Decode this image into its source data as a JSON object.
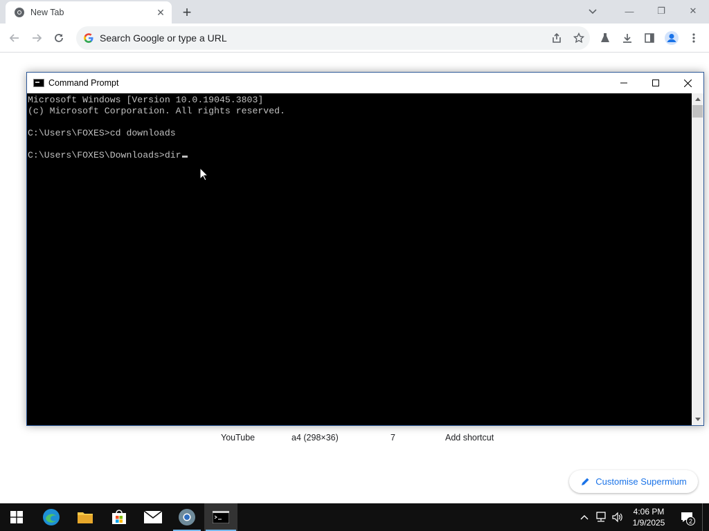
{
  "browser": {
    "tab": {
      "title": "New Tab"
    },
    "omnibox": {
      "placeholder": "Search Google or type a URL"
    }
  },
  "ntp": {
    "shortcuts": [
      "YouTube",
      "a4 (298×36)",
      "7",
      "Add shortcut"
    ],
    "customise_label": "Customise Supermium"
  },
  "cmd": {
    "title": "Command Prompt",
    "lines": [
      "Microsoft Windows [Version 10.0.19045.3803]",
      "(c) Microsoft Corporation. All rights reserved.",
      "",
      "C:\\Users\\FOXES>cd downloads",
      "",
      "C:\\Users\\FOXES\\Downloads>dir"
    ]
  },
  "taskbar": {
    "items": [
      "windows-start",
      "edge",
      "file-explorer",
      "microsoft-store",
      "mail",
      "supermium",
      "command-prompt"
    ],
    "clock": {
      "time": "4:06 PM",
      "date": "1/9/2025"
    },
    "notification_count": "2"
  },
  "colors": {
    "console_bg": "#000000",
    "console_text": "#c0c0c0",
    "accent": "#1a73e8",
    "taskbar": "#101010"
  }
}
